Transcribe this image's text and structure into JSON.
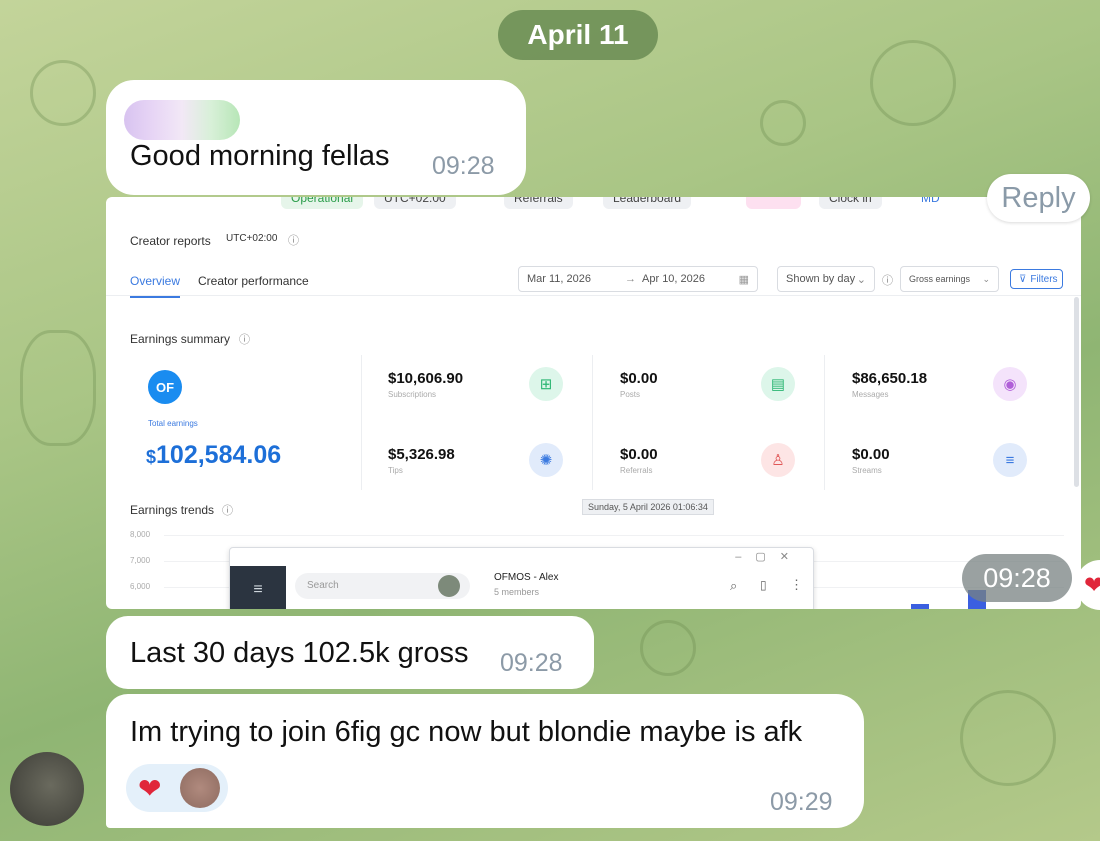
{
  "date_divider": "April 11",
  "messages": [
    {
      "text": "Good morning fellas",
      "time": "09:28"
    },
    {
      "time": "09:28"
    },
    {
      "text": "Last 30 days 102.5k gross",
      "time": "09:28"
    },
    {
      "text": "Im trying to join 6fig gc now but blondie maybe is afk",
      "time": "09:29"
    }
  ],
  "reply_button": "Reply",
  "screenshot": {
    "topbar": [
      "Operational",
      "UTC+02:00",
      "Referrals",
      "Leaderboard",
      "Clock in",
      "MD"
    ],
    "page_title": "Creator reports",
    "timezone": "UTC+02:00",
    "tabs": [
      "Overview",
      "Creator performance"
    ],
    "date_from": "Mar 11, 2026",
    "date_to": "Apr 10, 2026",
    "date_arrow": "→",
    "group_by": "Shown by day",
    "metric": "Gross earnings",
    "filters": "Filters",
    "earnings_summary_title": "Earnings summary",
    "total_label": "Total earnings",
    "total_currency": "$",
    "total_value": "102,584.06",
    "stats": [
      {
        "value": "$10,606.90",
        "label": "Subscriptions",
        "icon": "plus-square-icon",
        "color": "#2bb673"
      },
      {
        "value": "$0.00",
        "label": "Posts",
        "icon": "document-icon",
        "color": "#2bb673"
      },
      {
        "value": "$86,650.18",
        "label": "Messages",
        "icon": "chat-bubble-icon",
        "color": "#b05fd8"
      },
      {
        "value": "$5,326.98",
        "label": "Tips",
        "icon": "lightbulb-icon",
        "color": "#3b7ae0"
      },
      {
        "value": "$0.00",
        "label": "Referrals",
        "icon": "person-icon",
        "color": "#e05757"
      },
      {
        "value": "$0.00",
        "label": "Streams",
        "icon": "stack-icon",
        "color": "#3b7ae0"
      }
    ],
    "trends_title": "Earnings trends",
    "tooltip": "Sunday, 5 April 2026 01:06:34",
    "y_ticks": [
      "8,000",
      "7,000",
      "6,000"
    ],
    "mini_window": {
      "search_placeholder": "Search",
      "chat_title": "OFMOS - Alex",
      "chat_sub": "5 members",
      "win_controls": [
        "–",
        "▢",
        "✕"
      ]
    }
  },
  "colors": {
    "accent": "#3b7ae0",
    "bubble": "#ffffff",
    "time_text": "#8c9aa7"
  }
}
